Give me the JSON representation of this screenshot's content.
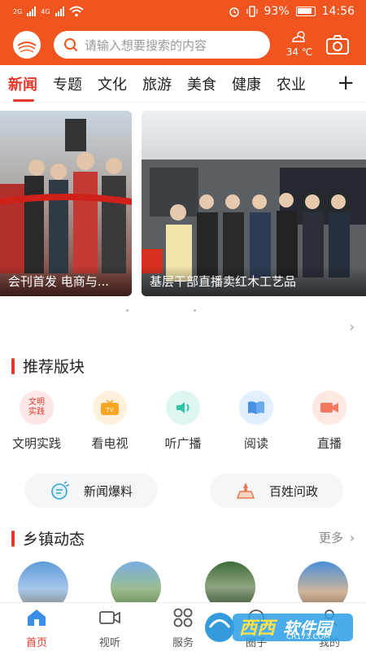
{
  "status_bar": {
    "network1": "2G",
    "network2": "4G",
    "battery": "93%",
    "time": "14:56"
  },
  "header": {
    "search_placeholder": "请输入想要搜索的内容",
    "temperature": "34 ℃",
    "accent_color": "#f0541f"
  },
  "tabs": [
    "新闻",
    "专题",
    "文化",
    "旅游",
    "美食",
    "健康",
    "农业"
  ],
  "carousel": {
    "slides": [
      {
        "caption": "会刊首发 电商与..."
      },
      {
        "caption": "基层干部直播卖红木工艺品"
      }
    ]
  },
  "recommended": {
    "title": "推荐版块",
    "items": [
      {
        "label": "文明实践",
        "icon": "civilization-badge-icon",
        "badge_text": "文明实践"
      },
      {
        "label": "看电视",
        "icon": "tv-icon"
      },
      {
        "label": "听广播",
        "icon": "speaker-icon"
      },
      {
        "label": "阅读",
        "icon": "book-icon"
      },
      {
        "label": "直播",
        "icon": "video-camera-icon"
      }
    ],
    "pills": [
      {
        "label": "新闻爆料",
        "icon": "news-tip-icon"
      },
      {
        "label": "百姓问政",
        "icon": "citizen-inquiry-icon"
      }
    ]
  },
  "towns": {
    "title": "乡镇动态",
    "more_label": "更多"
  },
  "bottom_nav": [
    {
      "label": "首页",
      "icon": "home-icon",
      "active": true
    },
    {
      "label": "视听",
      "icon": "video-icon",
      "active": false
    },
    {
      "label": "服务",
      "icon": "grid-circles-icon",
      "active": false
    },
    {
      "label": "圈子",
      "icon": "circle-icon",
      "active": false
    },
    {
      "label": "我的",
      "icon": "user-icon",
      "active": false
    }
  ],
  "watermark": {
    "text1": "西西",
    "text2": "软件园",
    "text3": "CR173.COM"
  }
}
